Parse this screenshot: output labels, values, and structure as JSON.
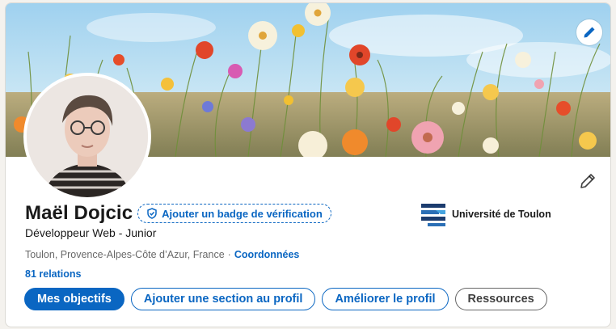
{
  "profile": {
    "name": "Maël Dojcic",
    "verify_badge_label": "Ajouter un badge de vérification",
    "headline": "Développeur Web - Junior",
    "location": "Toulon, Provence-Alpes-Côte d’Azur, France",
    "separator": "·",
    "contact_link": "Coordonnées",
    "connections": "81 relations"
  },
  "education": {
    "school_name": "Université de Toulon"
  },
  "actions": {
    "goals": "Mes objectifs",
    "add_section": "Ajouter une section au profil",
    "improve": "Améliorer le profil",
    "resources": "Ressources"
  },
  "colors": {
    "accent": "#0a66c2",
    "card_background": "#ffffff",
    "page_background": "#f4f2ee"
  },
  "icons": {
    "cover_edit": "pencil-icon",
    "profile_edit": "pencil-icon",
    "verify": "shield-check-icon",
    "school_logo": "university-logo"
  }
}
